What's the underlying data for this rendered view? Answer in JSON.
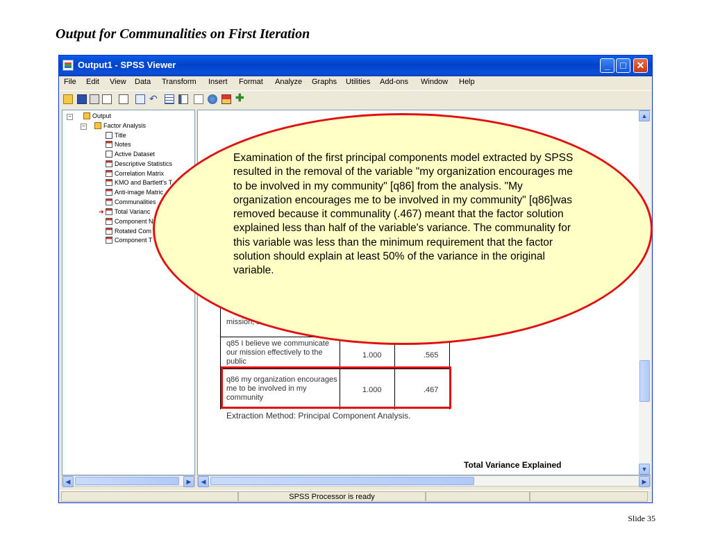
{
  "slide": {
    "title": "Output for Communalities on First Iteration",
    "number": "Slide 35"
  },
  "window": {
    "title": "Output1 - SPSS Viewer",
    "menu": [
      "File",
      "Edit",
      "View",
      "Data",
      "Transform",
      "Insert",
      "Format",
      "Analyze",
      "Graphs",
      "Utilities",
      "Add-ons",
      "Window",
      "Help"
    ],
    "status": "SPSS Processor is ready"
  },
  "outline": {
    "root": "Output",
    "group": "Factor Analysis",
    "items": [
      "Title",
      "Notes",
      "Active Dataset",
      "Descriptive Statistics",
      "Correlation Matrix",
      "KMO and Bartlett's T",
      "Anti-image Matric",
      "Communalities",
      "Total Varianc",
      "Component N",
      "Rotated Com",
      "Component T"
    ],
    "selected_marker": "➜"
  },
  "table": {
    "rows": [
      {
        "label": "mission, strategic plan",
        "initial": "",
        "extraction": ""
      },
      {
        "label": "q85  I believe we communicate our mission effectively to the public",
        "initial": "1.000",
        "extraction": ".565"
      },
      {
        "label": "q86  my organization encourages me to be involved in my community",
        "initial": "1.000",
        "extraction": ".467"
      }
    ],
    "footnote": "Extraction Method: Principal Component Analysis.",
    "next_table_title": "Total Variance Explained"
  },
  "callout": {
    "text": "Examination of the first principal components model extracted by SPSS resulted in the removal of the variable \"my organization encourages me to be involved in my community\" [q86] from the analysis. \"My organization encourages me to be involved in my community\" [q86]was removed because it communality (.467) meant that the factor solution explained less than half of the variable's variance. The communality for this variable was less than the minimum requirement that the factor solution should explain at least 50% of the variance in the original variable."
  },
  "colors": {
    "highlight": "#e01010",
    "callout_fill": "#ffffc6",
    "titlebar": "#0143c8"
  }
}
